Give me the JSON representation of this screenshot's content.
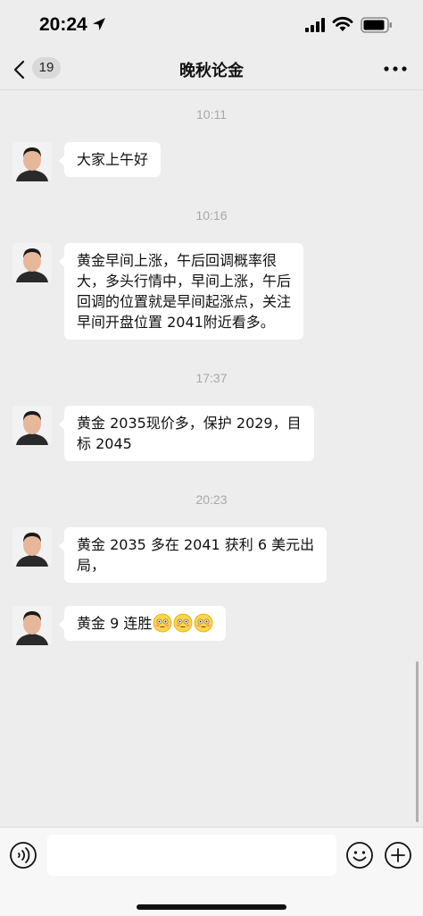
{
  "status_bar": {
    "time": "20:24",
    "icons": [
      "location-arrow-icon",
      "cellular-signal-icon",
      "wifi-icon",
      "battery-icon"
    ]
  },
  "nav": {
    "back_icon": "chevron-left-icon",
    "unread_count": "19",
    "title": "晚秋论金",
    "more_icon": "more-dots-icon"
  },
  "messages": [
    {
      "timestamp": "10:11",
      "sender_avatar": "avatar-man",
      "text": "大家上午好"
    },
    {
      "timestamp": "10:16",
      "sender_avatar": "avatar-man",
      "lines": [
        "黄金早间上涨，午后回调概率很",
        "大，多头行情中，早间上涨，午后",
        "回调的位置就是早间起涨点，关注",
        "早间开盘位置 2041附近看多。"
      ]
    },
    {
      "timestamp": "17:37",
      "sender_avatar": "avatar-man",
      "lines": [
        "黄金 2035现价多，保护 2029，目",
        "标 2045"
      ]
    },
    {
      "timestamp": "20:23",
      "sender_avatar": "avatar-man",
      "lines": [
        "黄金 2035 多在 2041 获利 6 美元出",
        "局，"
      ]
    },
    {
      "sender_avatar": "avatar-man",
      "text": "黄金 9 连胜",
      "emoji": [
        "flushed-face-icon",
        "flushed-face-icon",
        "flushed-face-icon"
      ]
    }
  ],
  "input_bar": {
    "voice_icon": "voice-icon",
    "input_value": "",
    "emoji_icon": "smile-icon",
    "plus_icon": "plus-icon"
  },
  "colors": {
    "background": "#ededed",
    "bubble": "#ffffff",
    "timestamp": "#a8a8a8",
    "input_bar": "#f7f7f7"
  }
}
